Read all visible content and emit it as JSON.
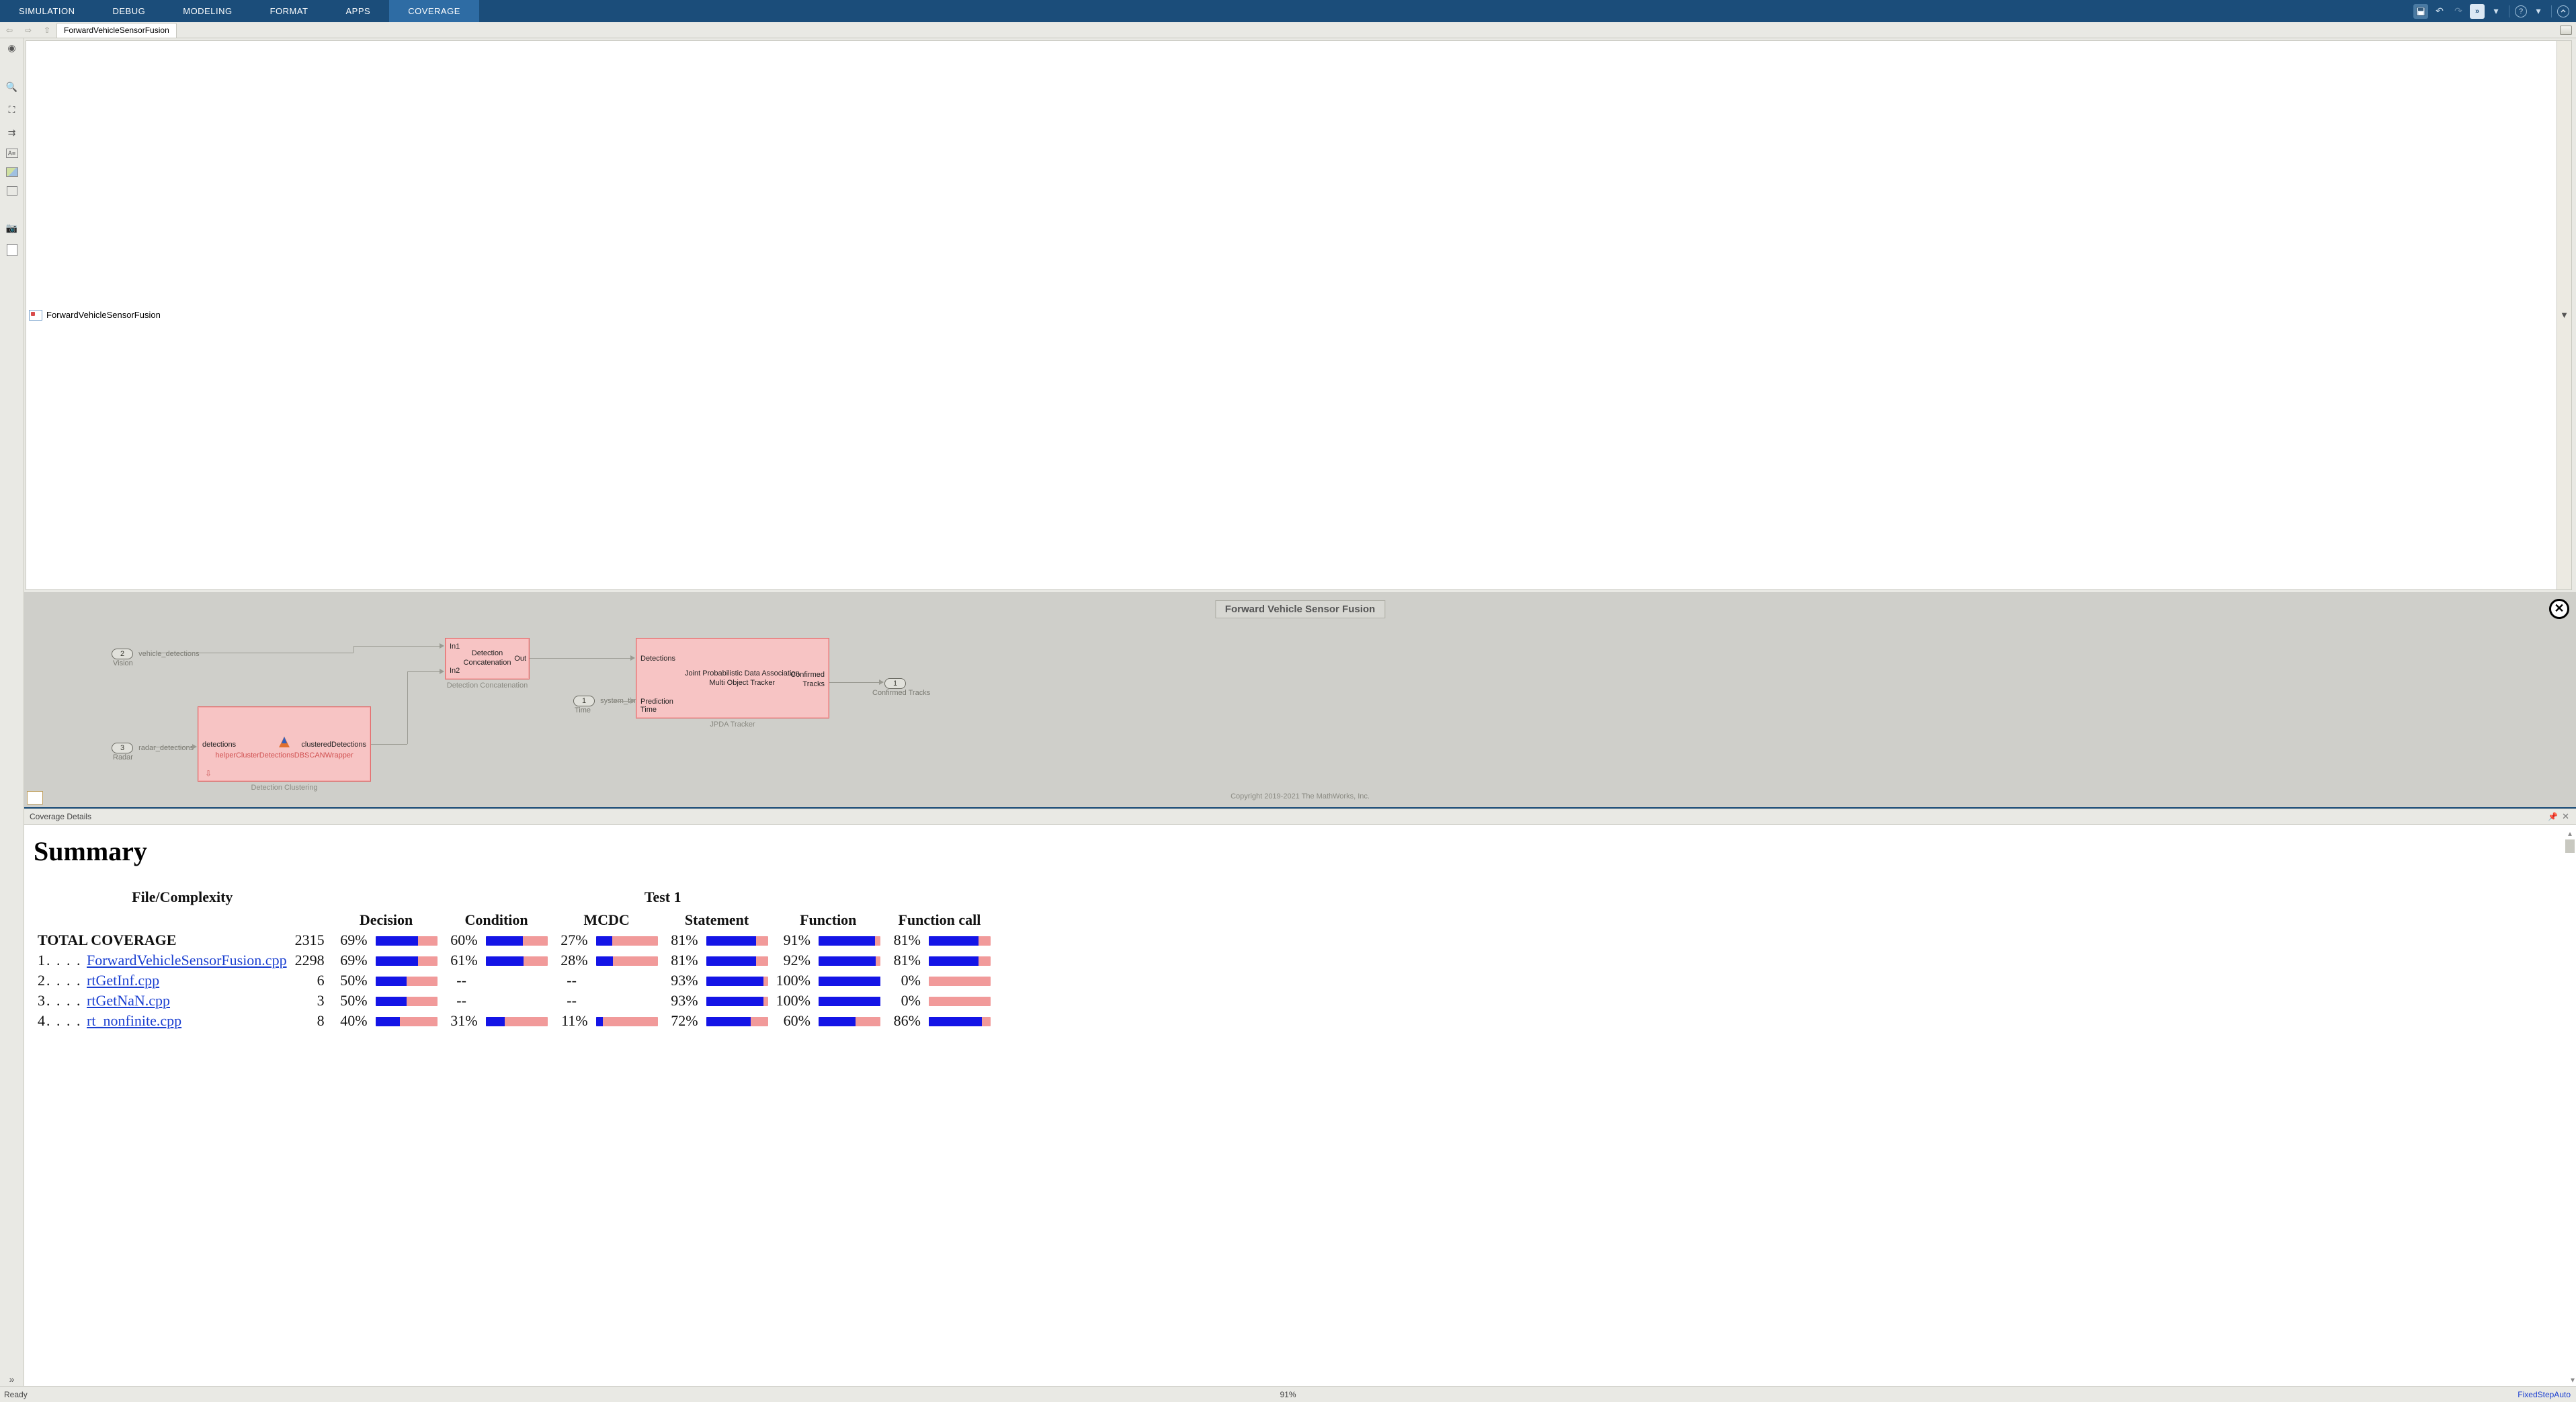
{
  "ribbon": {
    "tabs": [
      "SIMULATION",
      "DEBUG",
      "MODELING",
      "FORMAT",
      "APPS",
      "COVERAGE"
    ],
    "active_index": 5
  },
  "breadcrumb": {
    "tab_label": "ForwardVehicleSensorFusion"
  },
  "address": {
    "path": "ForwardVehicleSensorFusion"
  },
  "canvas": {
    "title": "Forward Vehicle Sensor Fusion",
    "copyright": "Copyright 2019-2021 The MathWorks, Inc.",
    "ports": {
      "vision": {
        "num": "2",
        "signal": "vehicle_detections",
        "label": "Vision"
      },
      "radar": {
        "num": "3",
        "signal": "radar_detections",
        "label": "Radar"
      },
      "time": {
        "num": "1",
        "signal": "system_time",
        "label": "Time"
      },
      "out": {
        "num": "1",
        "label": "Confirmed Tracks"
      }
    },
    "blocks": {
      "cluster": {
        "in": "detections",
        "out": "clusteredDetections",
        "name": "helperClusterDetectionsDBSCANWrapper",
        "sublabel": "Detection Clustering"
      },
      "concat": {
        "in1": "In1",
        "in2": "In2",
        "center1": "Detection",
        "center2": "Concatenation",
        "out": "Out",
        "sublabel": "Detection Concatenation"
      },
      "tracker": {
        "in1": "Detections",
        "in2": "Prediction",
        "in3": "Time",
        "center1": "Joint Probabilistic Data Association",
        "center2": "Multi Object Tracker",
        "out1": "Confirmed",
        "out2": "Tracks",
        "sublabel": "JPDA Tracker"
      }
    }
  },
  "coverage": {
    "panel_title": "Coverage Details",
    "heading": "Summary",
    "group_headers": {
      "left": "File/Complexity",
      "right": "Test 1"
    },
    "columns": [
      "Decision",
      "Condition",
      "MCDC",
      "Statement",
      "Function",
      "Function call"
    ],
    "total_label": "TOTAL COVERAGE",
    "total": {
      "complexity": "2315",
      "metrics": [
        {
          "pct": "69%",
          "v": 69
        },
        {
          "pct": "60%",
          "v": 60
        },
        {
          "pct": "27%",
          "v": 27
        },
        {
          "pct": "81%",
          "v": 81
        },
        {
          "pct": "91%",
          "v": 91
        },
        {
          "pct": "81%",
          "v": 81
        }
      ]
    },
    "rows": [
      {
        "idx": "1. . . . ",
        "name": "ForwardVehicleSensorFusion.cpp",
        "complexity": "2298",
        "metrics": [
          {
            "pct": "69%",
            "v": 69
          },
          {
            "pct": "61%",
            "v": 61
          },
          {
            "pct": "28%",
            "v": 28
          },
          {
            "pct": "81%",
            "v": 81
          },
          {
            "pct": "92%",
            "v": 92
          },
          {
            "pct": "81%",
            "v": 81
          }
        ]
      },
      {
        "idx": "2. . . . ",
        "name": "rtGetInf.cpp",
        "complexity": "6",
        "metrics": [
          {
            "pct": "50%",
            "v": 50
          },
          {
            "pct": "--",
            "v": null
          },
          {
            "pct": "--",
            "v": null
          },
          {
            "pct": "93%",
            "v": 93
          },
          {
            "pct": "100%",
            "v": 100
          },
          {
            "pct": "0%",
            "v": 0
          }
        ]
      },
      {
        "idx": "3. . . . ",
        "name": "rtGetNaN.cpp",
        "complexity": "3",
        "metrics": [
          {
            "pct": "50%",
            "v": 50
          },
          {
            "pct": "--",
            "v": null
          },
          {
            "pct": "--",
            "v": null
          },
          {
            "pct": "93%",
            "v": 93
          },
          {
            "pct": "100%",
            "v": 100
          },
          {
            "pct": "0%",
            "v": 0
          }
        ]
      },
      {
        "idx": "4. . . . ",
        "name": "rt_nonfinite.cpp",
        "complexity": "8",
        "metrics": [
          {
            "pct": "40%",
            "v": 40
          },
          {
            "pct": "31%",
            "v": 31
          },
          {
            "pct": "11%",
            "v": 11
          },
          {
            "pct": "72%",
            "v": 72
          },
          {
            "pct": "60%",
            "v": 60
          },
          {
            "pct": "86%",
            "v": 86
          }
        ]
      }
    ]
  },
  "status": {
    "left": "Ready",
    "center": "91%",
    "right": "FixedStepAuto"
  }
}
